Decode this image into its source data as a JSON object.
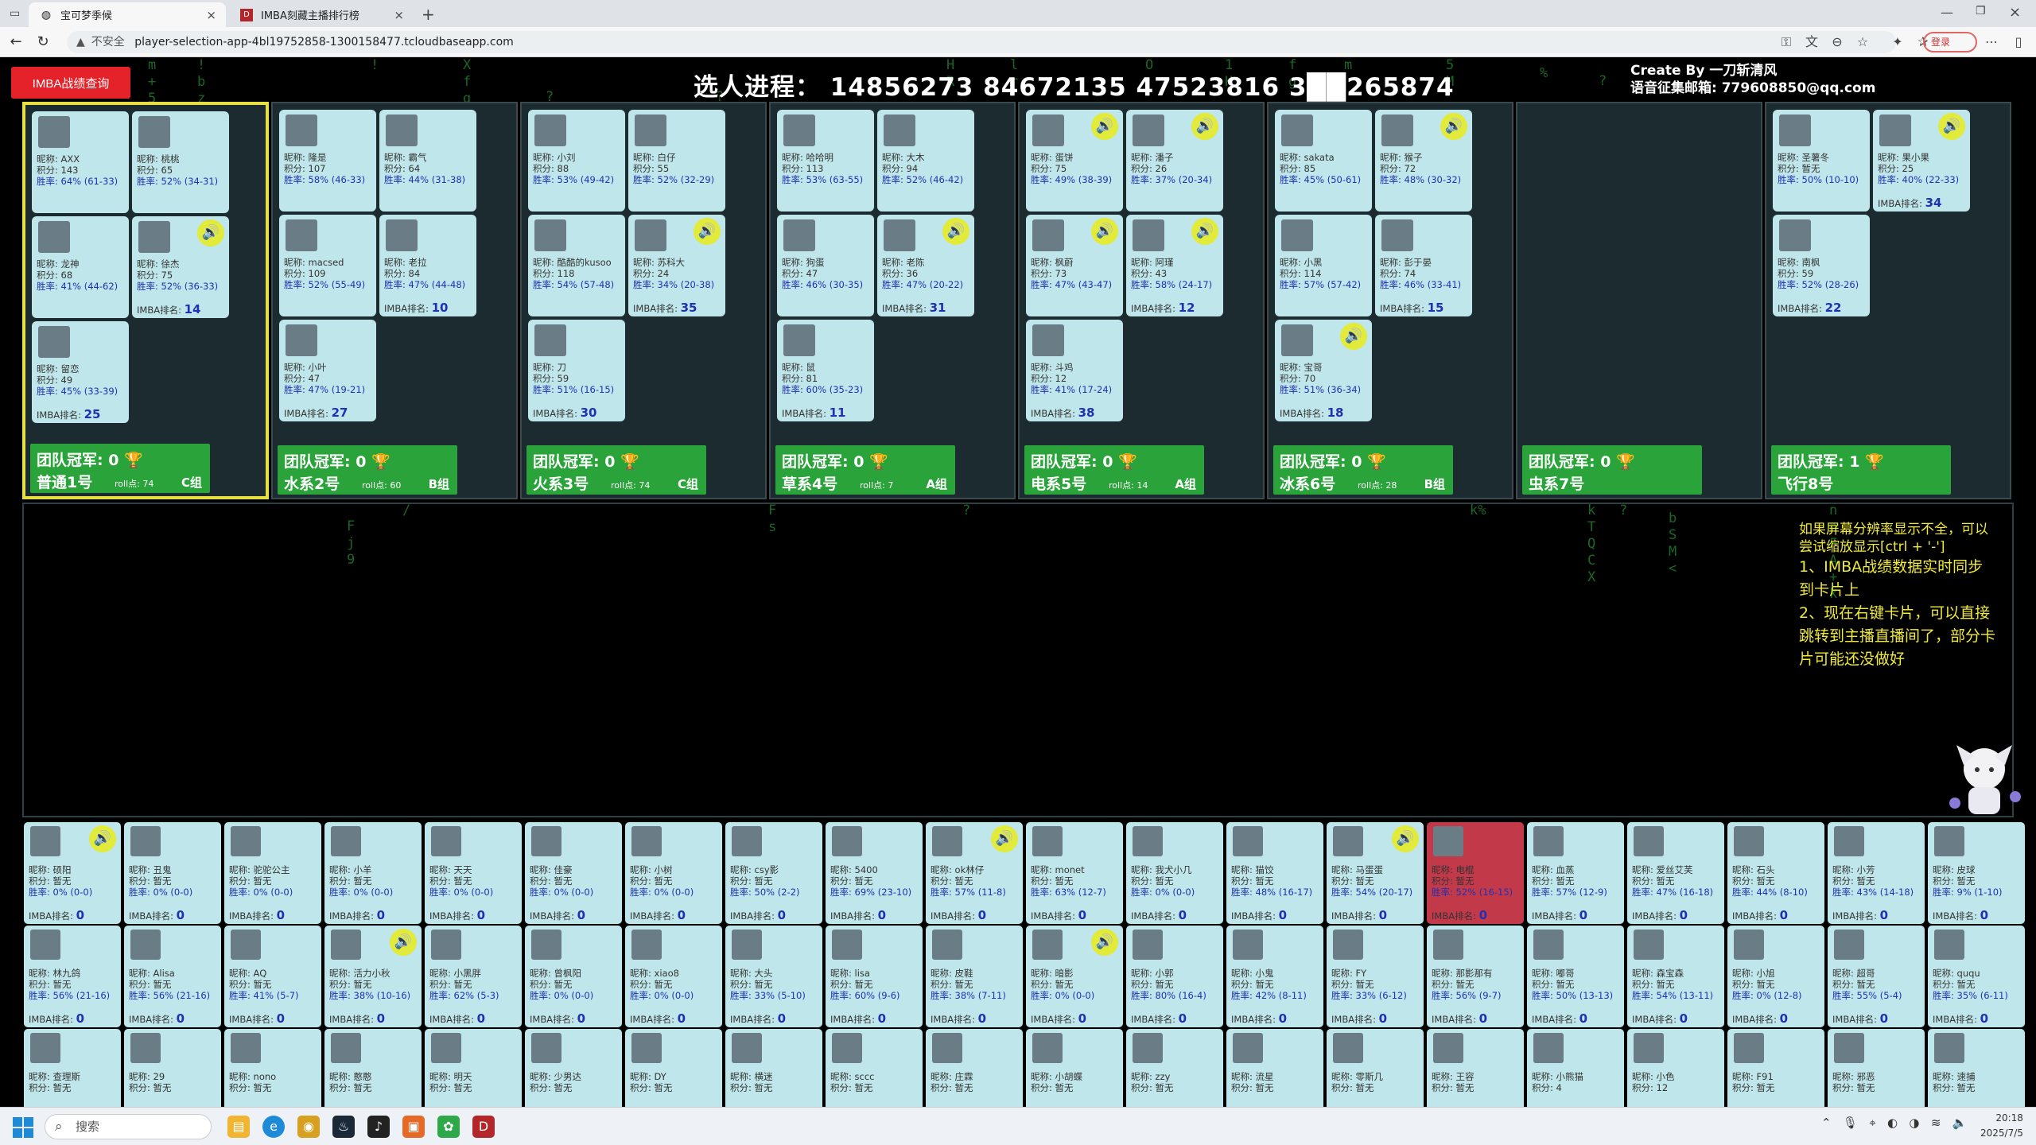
{
  "browser": {
    "tabs": [
      {
        "title": "宝可梦季候",
        "icon": "globe-icon",
        "active": true
      },
      {
        "title": "IMBA刻藏主播排行榜",
        "icon": "dota-icon",
        "active": false
      }
    ],
    "url": "player-selection-app-4bl19752858-1300158477.tcloudbaseapp.com",
    "security": "不安全",
    "profile_label": "登录"
  },
  "header": {
    "query_button": "IMBA战绩查询",
    "progress": "选人进程： 14856273 84672135 47523816 3██265874",
    "credit_line1": "Create By 一刀斩清风",
    "credit_line2": "语音征集邮箱: 779608850@qq.com"
  },
  "teams": [
    {
      "name": "普通1号",
      "champ": "团队冠军: 0",
      "rolls": "roll点: 74",
      "group": "C组",
      "selected": true,
      "players": [
        {
          "nick": "昵称: AXX",
          "score": "积分: 143",
          "rate": "胜率: 64% (61-33)",
          "rank": "",
          "voice": false
        },
        {
          "nick": "昵称: 桃桃",
          "score": "积分: 65",
          "rate": "胜率: 52% (34-31)",
          "rank": "",
          "voice": false
        },
        {
          "nick": "昵称: 龙神",
          "score": "积分: 68",
          "rate": "胜率: 41% (44-62)",
          "rank": "",
          "voice": false
        },
        {
          "nick": "昵称: 徐杰",
          "score": "积分: 75",
          "rate": "胜率: 52% (36-33)",
          "rank": "14",
          "voice": true
        },
        {
          "nick": "昵称: 留恋",
          "score": "积分: 49",
          "rate": "胜率: 45% (33-39)",
          "rank": "25",
          "voice": false
        }
      ]
    },
    {
      "name": "水系2号",
      "champ": "团队冠军: 0",
      "rolls": "roll点: 60",
      "group": "B组",
      "selected": false,
      "players": [
        {
          "nick": "昵称: 隆是",
          "score": "积分: 107",
          "rate": "胜率: 58% (46-33)",
          "rank": "",
          "voice": false
        },
        {
          "nick": "昵称: 霸气",
          "score": "积分: 64",
          "rate": "胜率: 44% (31-38)",
          "rank": "",
          "voice": false
        },
        {
          "nick": "昵称: macsed",
          "score": "积分: 109",
          "rate": "胜率: 52% (55-49)",
          "rank": "",
          "voice": false
        },
        {
          "nick": "昵称: 老拉",
          "score": "积分: 84",
          "rate": "胜率: 47% (44-48)",
          "rank": "10",
          "voice": false
        },
        {
          "nick": "昵称: 小叶",
          "score": "积分: 47",
          "rate": "胜率: 47% (19-21)",
          "rank": "27",
          "voice": false
        }
      ]
    },
    {
      "name": "火系3号",
      "champ": "团队冠军: 0",
      "rolls": "roll点: 74",
      "group": "C组",
      "selected": false,
      "players": [
        {
          "nick": "昵称: 小刘",
          "score": "积分: 88",
          "rate": "胜率: 53% (49-42)",
          "rank": "",
          "voice": false
        },
        {
          "nick": "昵称: 白仔",
          "score": "积分: 55",
          "rate": "胜率: 52% (32-29)",
          "rank": "",
          "voice": false
        },
        {
          "nick": "昵称: 酷酷的kusoo",
          "score": "积分: 118",
          "rate": "胜率: 54% (57-48)",
          "rank": "",
          "voice": false
        },
        {
          "nick": "昵称: 苏科大",
          "score": "积分: 24",
          "rate": "胜率: 34% (20-38)",
          "rank": "35",
          "voice": true
        },
        {
          "nick": "昵称: 刀",
          "score": "积分: 59",
          "rate": "胜率: 51% (16-15)",
          "rank": "30",
          "voice": false
        }
      ]
    },
    {
      "name": "草系4号",
      "champ": "团队冠军: 0",
      "rolls": "roll点: 7",
      "group": "A组",
      "selected": false,
      "players": [
        {
          "nick": "昵称: 哈哈明",
          "score": "积分: 113",
          "rate": "胜率: 53% (63-55)",
          "rank": "",
          "voice": false
        },
        {
          "nick": "昵称: 大木",
          "score": "积分: 94",
          "rate": "胜率: 52% (46-42)",
          "rank": "",
          "voice": false
        },
        {
          "nick": "昵称: 狗蛋",
          "score": "积分: 47",
          "rate": "胜率: 46% (30-35)",
          "rank": "",
          "voice": false
        },
        {
          "nick": "昵称: 老陈",
          "score": "积分: 36",
          "rate": "胜率: 47% (20-22)",
          "rank": "31",
          "voice": true
        },
        {
          "nick": "昵称: 鼠",
          "score": "积分: 81",
          "rate": "胜率: 60% (35-23)",
          "rank": "11",
          "voice": false
        }
      ]
    },
    {
      "name": "电系5号",
      "champ": "团队冠军: 0",
      "rolls": "roll点: 14",
      "group": "A组",
      "selected": false,
      "players": [
        {
          "nick": "昵称: 蛋饼",
          "score": "积分: 75",
          "rate": "胜率: 49% (38-39)",
          "rank": "",
          "voice": true
        },
        {
          "nick": "昵称: 潘子",
          "score": "积分: 26",
          "rate": "胜率: 37% (20-34)",
          "rank": "",
          "voice": true
        },
        {
          "nick": "昵称: 枫蔚",
          "score": "积分: 73",
          "rate": "胜率: 47% (43-47)",
          "rank": "",
          "voice": true
        },
        {
          "nick": "昵称: 阿瑾",
          "score": "积分: 43",
          "rate": "胜率: 58% (24-17)",
          "rank": "12",
          "voice": true
        },
        {
          "nick": "昵称: 斗鸡",
          "score": "积分: 12",
          "rate": "胜率: 41% (17-24)",
          "rank": "38",
          "voice": false
        }
      ]
    },
    {
      "name": "冰系6号",
      "champ": "团队冠军: 0",
      "rolls": "roll点: 28",
      "group": "B组",
      "selected": false,
      "players": [
        {
          "nick": "昵称: sakata",
          "score": "积分: 85",
          "rate": "胜率: 45% (50-61)",
          "rank": "",
          "voice": false
        },
        {
          "nick": "昵称: 猴子",
          "score": "积分: 72",
          "rate": "胜率: 48% (30-32)",
          "rank": "",
          "voice": true
        },
        {
          "nick": "昵称: 小黑",
          "score": "积分: 114",
          "rate": "胜率: 57% (57-42)",
          "rank": "",
          "voice": false
        },
        {
          "nick": "昵称: 彭于晏",
          "score": "积分: 74",
          "rate": "胜率: 46% (33-41)",
          "rank": "15",
          "voice": false
        },
        {
          "nick": "昵称: 宝哥",
          "score": "积分: 70",
          "rate": "胜率: 51% (36-34)",
          "rank": "18",
          "voice": true
        }
      ]
    },
    {
      "name": "虫系7号",
      "champ": "团队冠军: 0",
      "rolls": "",
      "group": "",
      "selected": false,
      "players": []
    },
    {
      "name": "飞行8号",
      "champ": "团队冠军: 1",
      "rolls": "",
      "group": "",
      "selected": false,
      "players": [
        {
          "nick": "昵称: 圣薯冬",
          "score": "积分: 暂无",
          "rate": "胜率: 50% (10-10)",
          "rank": "",
          "voice": false
        },
        {
          "nick": "昵称: 果小果",
          "score": "积分: 25",
          "rate": "胜率: 40% (22-33)",
          "rank": "34",
          "voice": true
        },
        {
          "nick": "昵称: 南枫",
          "score": "积分: 59",
          "rate": "胜率: 52% (28-26)",
          "rank": "22",
          "voice": false
        }
      ]
    }
  ],
  "notice": {
    "line1": "如果屏幕分辨率显示不全，可以尝试缩放显示[ctrl + '-']",
    "line2": "1、IMBA战绩数据实时同步到卡片上",
    "line3": "2、现在右键卡片，可以直接跳转到主播直播间了，部分卡片可能还没做好"
  },
  "pool": [
    {
      "nick": "昵称: 硕阳",
      "score": "积分: 暂无",
      "rate": "胜率: 0% (0-0)",
      "rank": "0",
      "voice": true
    },
    {
      "nick": "昵称: 丑鬼",
      "score": "积分: 暂无",
      "rate": "胜率: 0% (0-0)",
      "rank": "0",
      "voice": false
    },
    {
      "nick": "昵称: 驼驼公主",
      "score": "积分: 暂无",
      "rate": "胜率: 0% (0-0)",
      "rank": "0",
      "voice": false
    },
    {
      "nick": "昵称: 小羊",
      "score": "积分: 暂无",
      "rate": "胜率: 0% (0-0)",
      "rank": "0",
      "voice": false
    },
    {
      "nick": "昵称: 天天",
      "score": "积分: 暂无",
      "rate": "胜率: 0% (0-0)",
      "rank": "0",
      "voice": false
    },
    {
      "nick": "昵称: 佳豪",
      "score": "积分: 暂无",
      "rate": "胜率: 0% (0-0)",
      "rank": "0",
      "voice": false
    },
    {
      "nick": "昵称: 小树",
      "score": "积分: 暂无",
      "rate": "胜率: 0% (0-0)",
      "rank": "0",
      "voice": false
    },
    {
      "nick": "昵称: csy影",
      "score": "积分: 暂无",
      "rate": "胜率: 50% (2-2)",
      "rank": "0",
      "voice": false
    },
    {
      "nick": "昵称: 5400",
      "score": "积分: 暂无",
      "rate": "胜率: 69% (23-10)",
      "rank": "0",
      "voice": false
    },
    {
      "nick": "昵称: ok林仔",
      "score": "积分: 暂无",
      "rate": "胜率: 57% (11-8)",
      "rank": "0",
      "voice": true
    },
    {
      "nick": "昵称: monet",
      "score": "积分: 暂无",
      "rate": "胜率: 63% (12-7)",
      "rank": "0",
      "voice": false
    },
    {
      "nick": "昵称: 我犬小几",
      "score": "积分: 暂无",
      "rate": "胜率: 0% (0-0)",
      "rank": "0",
      "voice": false
    },
    {
      "nick": "昵称: 猫饺",
      "score": "积分: 暂无",
      "rate": "胜率: 48% (16-17)",
      "rank": "0",
      "voice": false
    },
    {
      "nick": "昵称: 马蛋蛋",
      "score": "积分: 暂无",
      "rate": "胜率: 54% (20-17)",
      "rank": "0",
      "voice": true
    },
    {
      "nick": "昵称: 电棍",
      "score": "积分: 暂无",
      "rate": "胜率: 52% (16-15)",
      "rank": "0",
      "voice": false,
      "red": true
    },
    {
      "nick": "昵称: 血蒸",
      "score": "积分: 暂无",
      "rate": "胜率: 57% (12-9)",
      "rank": "0",
      "voice": false
    },
    {
      "nick": "昵称: 爱丝艾芙",
      "score": "积分: 暂无",
      "rate": "胜率: 47% (16-18)",
      "rank": "0",
      "voice": false
    },
    {
      "nick": "昵称: 石头",
      "score": "积分: 暂无",
      "rate": "胜率: 44% (8-10)",
      "rank": "0",
      "voice": false
    },
    {
      "nick": "昵称: 小芳",
      "score": "积分: 暂无",
      "rate": "胜率: 43% (14-18)",
      "rank": "0",
      "voice": false
    },
    {
      "nick": "昵称: 皮球",
      "score": "积分: 暂无",
      "rate": "胜率: 9% (1-10)",
      "rank": "0",
      "voice": false
    },
    {
      "nick": "昵称: 林九鸽",
      "score": "积分: 暂无",
      "rate": "胜率: 56% (21-16)",
      "rank": "0",
      "voice": false
    },
    {
      "nick": "昵称: Alisa",
      "score": "积分: 暂无",
      "rate": "胜率: 56% (21-16)",
      "rank": "0",
      "voice": false
    },
    {
      "nick": "昵称: AQ",
      "score": "积分: 暂无",
      "rate": "胜率: 41% (5-7)",
      "rank": "0",
      "voice": false
    },
    {
      "nick": "昵称: 活力小秋",
      "score": "积分: 暂无",
      "rate": "胜率: 38% (10-16)",
      "rank": "0",
      "voice": true
    },
    {
      "nick": "昵称: 小黑胖",
      "score": "积分: 暂无",
      "rate": "胜率: 62% (5-3)",
      "rank": "0",
      "voice": false
    },
    {
      "nick": "昵称: 曾枫阳",
      "score": "积分: 暂无",
      "rate": "胜率: 0% (0-0)",
      "rank": "0",
      "voice": false
    },
    {
      "nick": "昵称: xiao8",
      "score": "积分: 暂无",
      "rate": "胜率: 0% (0-0)",
      "rank": "0",
      "voice": false
    },
    {
      "nick": "昵称: 大头",
      "score": "积分: 暂无",
      "rate": "胜率: 33% (5-10)",
      "rank": "0",
      "voice": false
    },
    {
      "nick": "昵称: lisa",
      "score": "积分: 暂无",
      "rate": "胜率: 60% (9-6)",
      "rank": "0",
      "voice": false
    },
    {
      "nick": "昵称: 皮鞋",
      "score": "积分: 暂无",
      "rate": "胜率: 38% (7-11)",
      "rank": "0",
      "voice": false
    },
    {
      "nick": "昵称: 暗影",
      "score": "积分: 暂无",
      "rate": "胜率: 0% (0-0)",
      "rank": "0",
      "voice": true
    },
    {
      "nick": "昵称: 小郭",
      "score": "积分: 暂无",
      "rate": "胜率: 80% (16-4)",
      "rank": "0",
      "voice": false
    },
    {
      "nick": "昵称: 小鬼",
      "score": "积分: 暂无",
      "rate": "胜率: 42% (8-11)",
      "rank": "0",
      "voice": false
    },
    {
      "nick": "昵称: FY",
      "score": "积分: 暂无",
      "rate": "胜率: 33% (6-12)",
      "rank": "0",
      "voice": false
    },
    {
      "nick": "昵称: 那影那有",
      "score": "积分: 暂无",
      "rate": "胜率: 56% (9-7)",
      "rank": "0",
      "voice": false
    },
    {
      "nick": "昵称: 嘟哥",
      "score": "积分: 暂无",
      "rate": "胜率: 50% (13-13)",
      "rank": "0",
      "voice": false
    },
    {
      "nick": "昵称: 森宝森",
      "score": "积分: 暂无",
      "rate": "胜率: 54% (13-11)",
      "rank": "0",
      "voice": false
    },
    {
      "nick": "昵称: 小旭",
      "score": "积分: 暂无",
      "rate": "胜率: 0% (12-8)",
      "rank": "0",
      "voice": false
    },
    {
      "nick": "昵称: 超哥",
      "score": "积分: 暂无",
      "rate": "胜率: 55% (5-4)",
      "rank": "0",
      "voice": false
    },
    {
      "nick": "昵称: ququ",
      "score": "积分: 暂无",
      "rate": "胜率: 35% (6-11)",
      "rank": "0",
      "voice": false
    },
    {
      "nick": "昵称: 查理斯",
      "score": "积分: 暂无",
      "rate": "",
      "rank": "",
      "voice": false
    },
    {
      "nick": "昵称: 29",
      "score": "积分: 暂无",
      "rate": "",
      "rank": "",
      "voice": false
    },
    {
      "nick": "昵称: nono",
      "score": "积分: 暂无",
      "rate": "",
      "rank": "",
      "voice": false
    },
    {
      "nick": "昵称: 憨憨",
      "score": "积分: 暂无",
      "rate": "",
      "rank": "",
      "voice": false
    },
    {
      "nick": "昵称: 明天",
      "score": "积分: 暂无",
      "rate": "",
      "rank": "",
      "voice": false
    },
    {
      "nick": "昵称: 少男达",
      "score": "积分: 暂无",
      "rate": "",
      "rank": "",
      "voice": false
    },
    {
      "nick": "昵称: DY",
      "score": "积分: 暂无",
      "rate": "",
      "rank": "",
      "voice": false
    },
    {
      "nick": "昵称: 横迷",
      "score": "积分: 暂无",
      "rate": "",
      "rank": "",
      "voice": false
    },
    {
      "nick": "昵称: sccc",
      "score": "积分: 暂无",
      "rate": "",
      "rank": "",
      "voice": false
    },
    {
      "nick": "昵称: 庄霖",
      "score": "积分: 暂无",
      "rate": "",
      "rank": "",
      "voice": false
    },
    {
      "nick": "昵称: 小胡蝶",
      "score": "积分: 暂无",
      "rate": "",
      "rank": "",
      "voice": false
    },
    {
      "nick": "昵称: zzy",
      "score": "积分: 暂无",
      "rate": "",
      "rank": "",
      "voice": false
    },
    {
      "nick": "昵称: 流星",
      "score": "积分: 暂无",
      "rate": "",
      "rank": "",
      "voice": false
    },
    {
      "nick": "昵称: 零斯几",
      "score": "积分: 暂无",
      "rate": "",
      "rank": "",
      "voice": false
    },
    {
      "nick": "昵称: 王容",
      "score": "积分: 暂无",
      "rate": "",
      "rank": "",
      "voice": false
    },
    {
      "nick": "昵称: 小熊猫",
      "score": "积分: 4",
      "rate": "",
      "rank": "",
      "voice": false
    },
    {
      "nick": "昵称: 小色",
      "score": "积分: 12",
      "rate": "",
      "rank": "",
      "voice": false
    },
    {
      "nick": "昵称: F91",
      "score": "积分: 暂无",
      "rate": "",
      "rank": "",
      "voice": false
    },
    {
      "nick": "昵称: 邪恶",
      "score": "积分: 暂无",
      "rate": "",
      "rank": "",
      "voice": false
    },
    {
      "nick": "昵称: 速捕",
      "score": "积分: 暂无",
      "rate": "",
      "rank": "",
      "voice": false
    }
  ],
  "labels": {
    "rank_prefix": "IMBA排名: ",
    "voice_glyph": "🔊",
    "trophy_glyph": "🏆"
  },
  "taskbar": {
    "search_placeholder": "搜索",
    "time": "20:18",
    "date": "2025/7/5"
  },
  "colors": {
    "card_bg": "#bfe6ea",
    "team_foot": "#2aa43a",
    "accent_yellow": "#e8e040",
    "query_red": "#e5222a",
    "rain_green": "#1f7a2a",
    "voice_yellow": "#e2ea3a"
  }
}
